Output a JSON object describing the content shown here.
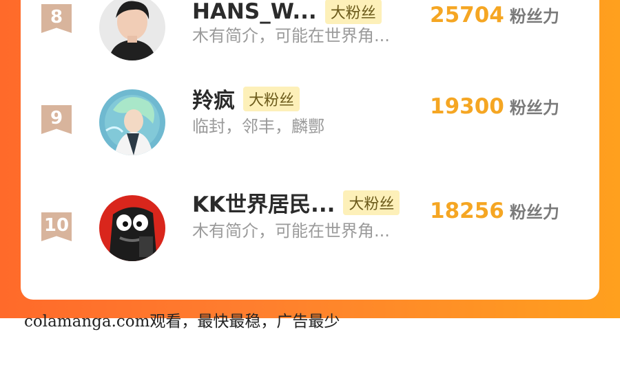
{
  "rows": [
    {
      "rank": "8",
      "name": "HANS_W...",
      "badge": "大粉丝",
      "desc": "木有简介，可能在世界角...",
      "score": "25704",
      "unit": "粉丝力"
    },
    {
      "rank": "9",
      "name": "羚疯",
      "badge": "大粉丝",
      "desc": "临封，邻丰，麟酆",
      "score": "19300",
      "unit": "粉丝力"
    },
    {
      "rank": "10",
      "name": "KK世界居民...",
      "badge": "大粉丝",
      "desc": "木有简介，可能在世界角...",
      "score": "18256",
      "unit": "粉丝力"
    }
  ],
  "footer": "colamanga.com观看，最快最稳，广告最少",
  "colors": {
    "accent_orange": "#ff7e2e",
    "score": "#f5a623",
    "rank_ribbon": "#d8b49c",
    "badge_bg": "#fdf0b9"
  },
  "icons": [
    "ribbon-rank-icon",
    "avatar-portrait",
    "avatar-anime",
    "avatar-cartoon"
  ]
}
